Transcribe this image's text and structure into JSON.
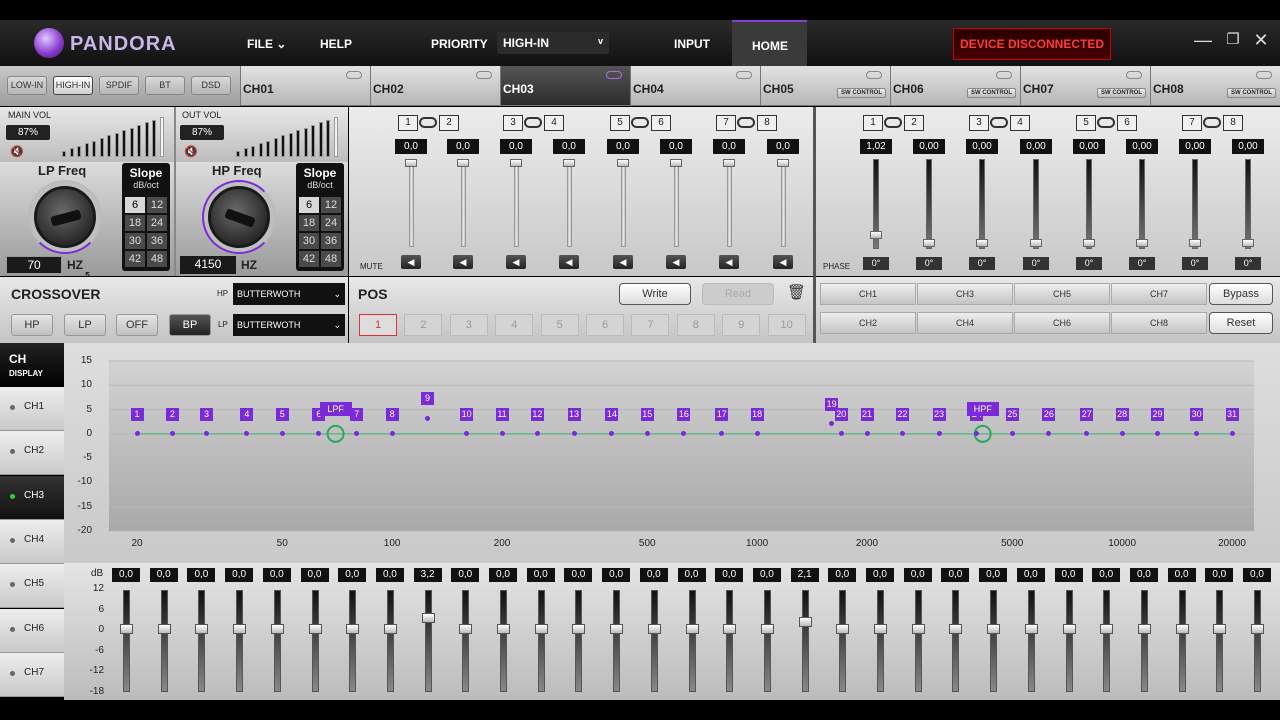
{
  "app": {
    "title": "PANDORA"
  },
  "topbar": {
    "file": "FILE",
    "help": "HELP",
    "priority_label": "PRIORITY",
    "priority_value": "HIGH-IN",
    "priority_chev": "v",
    "input": "INPUT",
    "home": "HOME",
    "status": "DEVICE DISCONNECTED"
  },
  "sources": [
    "LOW-IN",
    "HIGH-IN",
    "SPDIF",
    "BT",
    "DSD"
  ],
  "channels": [
    {
      "label": "CH01",
      "sw": ""
    },
    {
      "label": "CH02",
      "sw": ""
    },
    {
      "label": "CH03",
      "sw": ""
    },
    {
      "label": "CH04",
      "sw": ""
    },
    {
      "label": "CH05",
      "sw": "SW CONTROL"
    },
    {
      "label": "CH06",
      "sw": "SW CONTROL"
    },
    {
      "label": "CH07",
      "sw": "SW CONTROL"
    },
    {
      "label": "CH08",
      "sw": "SW CONTROL"
    }
  ],
  "volume": {
    "main_label": "MAIN VOL",
    "main_value": "87%",
    "main_level": 0.87,
    "out_label": "OUT VOL",
    "out_value": "87%",
    "out_level": 0.87
  },
  "lp": {
    "title": "LP Freq",
    "value": "70",
    "unit": "HZ"
  },
  "hp": {
    "title": "HP Freq",
    "value": "4150",
    "unit": "HZ"
  },
  "slope": {
    "title": "Slope",
    "unit": "dB/oct",
    "options": [
      "6",
      "12",
      "18",
      "24",
      "30",
      "36",
      "42",
      "48"
    ],
    "lp_selected": "6",
    "hp_selected": "6"
  },
  "input_gain": {
    "pairs": [
      [
        "1",
        "2"
      ],
      [
        "3",
        "4"
      ],
      [
        "5",
        "6"
      ],
      [
        "7",
        "8"
      ]
    ],
    "values": [
      "0,0",
      "0,0",
      "0,0",
      "0,0",
      "0,0",
      "0,0",
      "0,0",
      "0,0"
    ],
    "mute_label": "MUTE"
  },
  "output_gain": {
    "pairs": [
      [
        "1",
        "2"
      ],
      [
        "3",
        "4"
      ],
      [
        "5",
        "6"
      ],
      [
        "7",
        "8"
      ]
    ],
    "values": [
      "1,02",
      "0,00",
      "0,00",
      "0,00",
      "0,00",
      "0,00",
      "0,00",
      "0,00"
    ],
    "phase_label": "PHASE",
    "phases": [
      "0°",
      "0°",
      "0°",
      "0°",
      "0°",
      "0°",
      "0°",
      "0°"
    ]
  },
  "crossover": {
    "title": "CROSSOVER",
    "modes": [
      "HP",
      "LP",
      "OFF",
      "BP"
    ],
    "selected": "BP",
    "hp_label": "HP",
    "hp_filter": "BUTTERWOTH",
    "lp_label": "LP",
    "lp_filter": "BUTTERWOTH"
  },
  "pos": {
    "title": "POS",
    "write": "Write",
    "read": "Read",
    "buttons": [
      "1",
      "2",
      "3",
      "4",
      "5",
      "6",
      "7",
      "8",
      "9",
      "10"
    ]
  },
  "copy": {
    "row1": [
      "CH1",
      "CH3",
      "CH5",
      "CH7"
    ],
    "row2": [
      "CH2",
      "CH4",
      "CH6",
      "CH8"
    ],
    "bypass": "Bypass",
    "reset": "Reset"
  },
  "display": {
    "title": "CH",
    "subtitle": "DISPLAY",
    "items": [
      "CH1",
      "CH2",
      "CH3",
      "CH4",
      "CH5",
      "CH6",
      "CH7"
    ],
    "selected": "CH3"
  },
  "chart_data": {
    "type": "line",
    "y_ticks": [
      "15",
      "10",
      "5",
      "0",
      "-5",
      "-10",
      "-15",
      "-20"
    ],
    "ylim": [
      -20,
      15
    ],
    "x_ticks": [
      "20",
      "50",
      "100",
      "200",
      "500",
      "1000",
      "2000",
      "5000",
      "10000",
      "20000"
    ],
    "xscale": "log",
    "bands": [
      {
        "n": "1",
        "f": 20,
        "g": 0
      },
      {
        "n": "2",
        "f": 25,
        "g": 0
      },
      {
        "n": "3",
        "f": 31,
        "g": 0
      },
      {
        "n": "4",
        "f": 40,
        "g": 0
      },
      {
        "n": "5",
        "f": 50,
        "g": 0
      },
      {
        "n": "6",
        "f": 63,
        "g": 0
      },
      {
        "n": "7",
        "f": 80,
        "g": 0
      },
      {
        "n": "8",
        "f": 100,
        "g": 0
      },
      {
        "n": "9",
        "f": 125,
        "g": 3.2
      },
      {
        "n": "10",
        "f": 160,
        "g": 0
      },
      {
        "n": "11",
        "f": 200,
        "g": 0
      },
      {
        "n": "12",
        "f": 250,
        "g": 0
      },
      {
        "n": "13",
        "f": 315,
        "g": 0
      },
      {
        "n": "14",
        "f": 400,
        "g": 0
      },
      {
        "n": "15",
        "f": 500,
        "g": 0
      },
      {
        "n": "16",
        "f": 630,
        "g": 0
      },
      {
        "n": "17",
        "f": 800,
        "g": 0
      },
      {
        "n": "18",
        "f": 1000,
        "g": 0
      },
      {
        "n": "19",
        "f": 1600,
        "g": 2.1
      },
      {
        "n": "20",
        "f": 1700,
        "g": 0
      },
      {
        "n": "21",
        "f": 2000,
        "g": 0
      },
      {
        "n": "22",
        "f": 2500,
        "g": 0
      },
      {
        "n": "23",
        "f": 3150,
        "g": 0
      },
      {
        "n": "24",
        "f": 4000,
        "g": 0
      },
      {
        "n": "25",
        "f": 5000,
        "g": 0
      },
      {
        "n": "26",
        "f": 6300,
        "g": 0
      },
      {
        "n": "27",
        "f": 8000,
        "g": 0
      },
      {
        "n": "28",
        "f": 10000,
        "g": 0
      },
      {
        "n": "29",
        "f": 12500,
        "g": 0
      },
      {
        "n": "30",
        "f": 16000,
        "g": 0
      },
      {
        "n": "31",
        "f": 20000,
        "g": 0
      }
    ],
    "markers": [
      {
        "label": "LPF",
        "f": 70
      },
      {
        "label": "HPF",
        "f": 4150
      }
    ]
  },
  "eq": {
    "db_label": "dB",
    "scale": [
      "12",
      "6",
      "0",
      "-6",
      "-12",
      "-18"
    ],
    "values": [
      "0,0",
      "0,0",
      "0,0",
      "0,0",
      "0,0",
      "0,0",
      "0,0",
      "0,0",
      "3,2",
      "0,0",
      "0,0",
      "0,0",
      "0,0",
      "0,0",
      "0,0",
      "0,0",
      "0,0",
      "0,0",
      "2,1",
      "0,0",
      "0,0",
      "0,0",
      "0,0",
      "0,0",
      "0,0",
      "0,0",
      "0,0",
      "0,0",
      "0,0",
      "0,0",
      "0,0"
    ],
    "gains": [
      0,
      0,
      0,
      0,
      0,
      0,
      0,
      0,
      3.2,
      0,
      0,
      0,
      0,
      0,
      0,
      0,
      0,
      0,
      2.1,
      0,
      0,
      0,
      0,
      0,
      0,
      0,
      0,
      0,
      0,
      0,
      0
    ]
  },
  "colors": {
    "accent": "#7a2ad8",
    "status": "#ff3b3b"
  }
}
